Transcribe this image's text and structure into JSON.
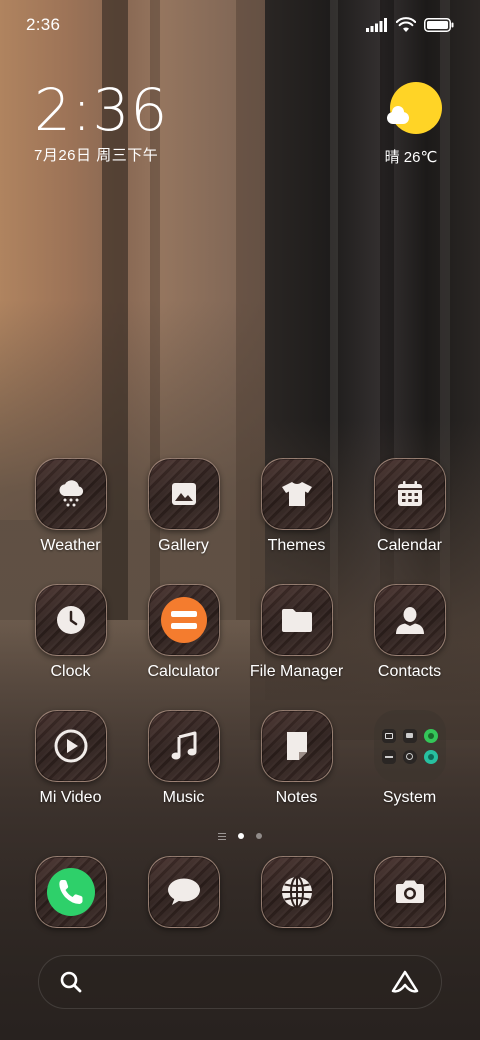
{
  "status_bar": {
    "time": "2:36"
  },
  "clock_widget": {
    "time": "2:36",
    "date": "7月26日 周三下午"
  },
  "weather_widget": {
    "condition_temp": "晴 26℃"
  },
  "apps": [
    {
      "label": "Weather",
      "icon": "cloud-snow-icon"
    },
    {
      "label": "Gallery",
      "icon": "image-icon"
    },
    {
      "label": "Themes",
      "icon": "tshirt-icon"
    },
    {
      "label": "Calendar",
      "icon": "calendar-icon"
    },
    {
      "label": "Clock",
      "icon": "clock-icon"
    },
    {
      "label": "Calculator",
      "icon": "calculator-icon"
    },
    {
      "label": "File Manager",
      "icon": "folder-icon"
    },
    {
      "label": "Contacts",
      "icon": "person-icon"
    },
    {
      "label": "Mi Video",
      "icon": "play-icon"
    },
    {
      "label": "Music",
      "icon": "music-note-icon"
    },
    {
      "label": "Notes",
      "icon": "note-icon"
    },
    {
      "label": "System",
      "icon": "folder-grid-icon"
    }
  ],
  "dock": [
    {
      "icon": "phone-icon"
    },
    {
      "icon": "message-icon"
    },
    {
      "icon": "globe-icon"
    },
    {
      "icon": "camera-icon"
    }
  ],
  "colors": {
    "sun": "#ffd426",
    "phone_green": "#2ed06a",
    "calculator_orange": "#f47c2e"
  }
}
